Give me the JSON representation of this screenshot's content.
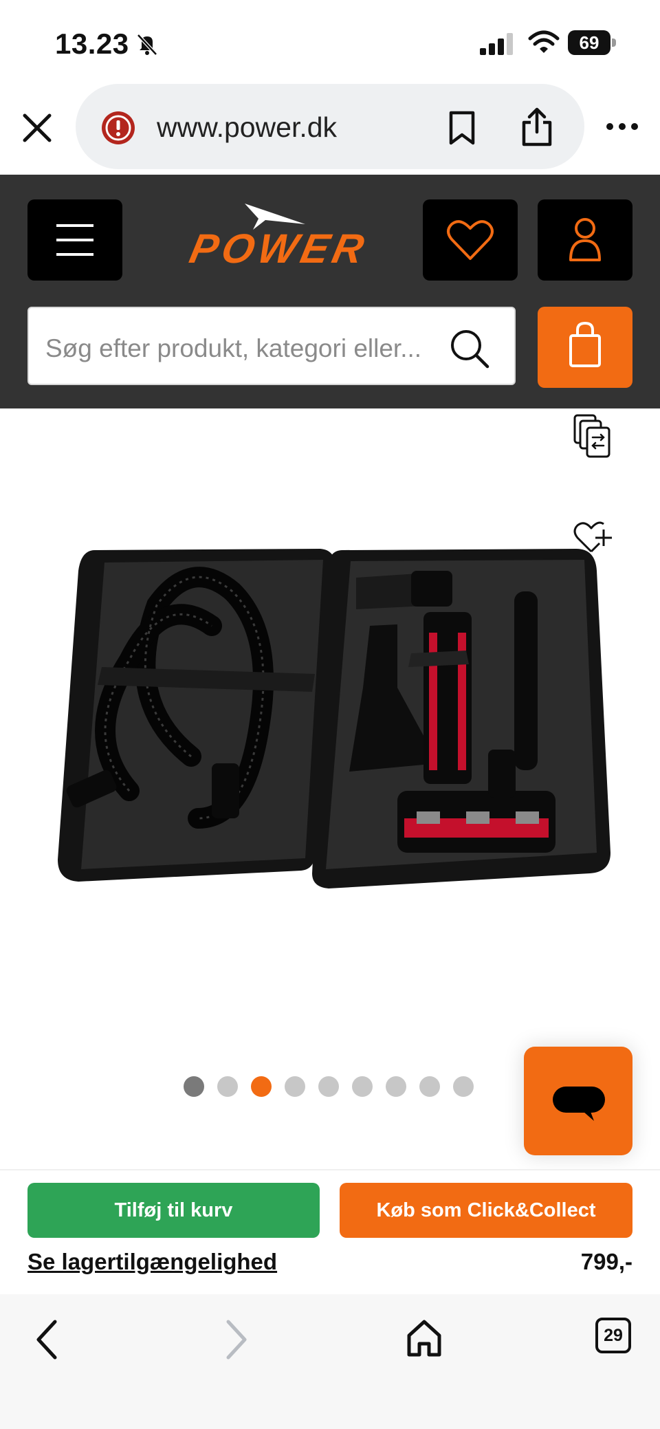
{
  "status_bar": {
    "time": "13.23",
    "battery": "69"
  },
  "browser": {
    "url": "www.power.dk",
    "tab_count": "29"
  },
  "site": {
    "brand": "POWER",
    "search_placeholder": "Søg efter produkt, kategori eller...",
    "accent_color": "#f26b13",
    "header_bg": "#333333"
  },
  "carousel": {
    "total": 9,
    "active_index": 2,
    "first_seen_index": 0
  },
  "actions": {
    "add_to_cart": "Tilføj til kurv",
    "click_collect": "Køb som Click&Collect",
    "stock_link": "Se lagertilgængelighed",
    "price": "799,-"
  },
  "icons": {
    "status": [
      "bell-off-icon",
      "signal-icon",
      "wifi-icon",
      "battery-icon"
    ],
    "browser": [
      "close-icon",
      "security-warning-icon",
      "bookmark-icon",
      "share-icon",
      "more-icon"
    ],
    "header": [
      "menu-icon",
      "heart-icon",
      "user-icon",
      "search-icon",
      "shopping-bag-icon"
    ],
    "product": [
      "compare-icon",
      "wishlist-add-icon",
      "chat-icon"
    ],
    "nav": [
      "back-icon",
      "forward-icon",
      "home-icon",
      "tabs-icon"
    ]
  }
}
